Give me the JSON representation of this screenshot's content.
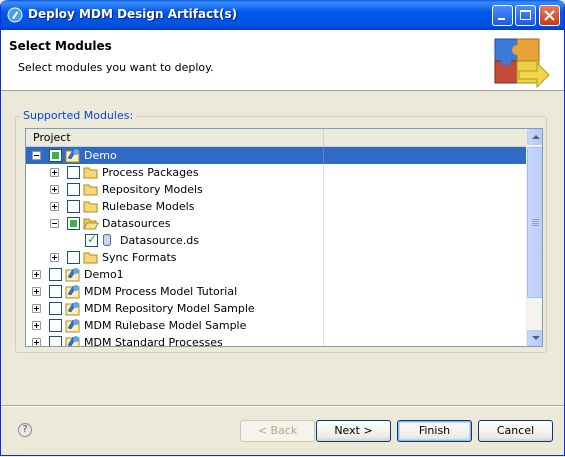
{
  "window": {
    "title": "Deploy MDM Design Artifact(s)"
  },
  "banner": {
    "title": "Select Modules",
    "message": "Select modules you want to deploy."
  },
  "group": {
    "label": "Supported Modules:"
  },
  "tree": {
    "column_header": "Project",
    "rows": [
      {
        "label": "Demo",
        "icon": "project-icon",
        "expander": "minus",
        "check": "partial",
        "selected": true
      },
      {
        "label": "Process Packages",
        "icon": "folder-icon",
        "expander": "plus",
        "check": "unchecked"
      },
      {
        "label": "Repository Models",
        "icon": "folder-icon",
        "expander": "plus",
        "check": "unchecked"
      },
      {
        "label": "Rulebase Models",
        "icon": "folder-icon",
        "expander": "plus",
        "check": "unchecked"
      },
      {
        "label": "Datasources",
        "icon": "folder-open-icon",
        "expander": "minus",
        "check": "partial"
      },
      {
        "label": "Datasource.ds",
        "icon": "datasource-file-icon",
        "expander": "none",
        "check": "checked"
      },
      {
        "label": "Sync Formats",
        "icon": "folder-icon",
        "expander": "plus",
        "check": "unchecked"
      },
      {
        "label": "Demo1",
        "icon": "project-icon",
        "expander": "plus",
        "check": "unchecked"
      },
      {
        "label": "MDM Process Model Tutorial",
        "icon": "project-icon",
        "expander": "plus",
        "check": "unchecked"
      },
      {
        "label": "MDM Repository Model Sample",
        "icon": "project-icon",
        "expander": "plus",
        "check": "unchecked"
      },
      {
        "label": "MDM Rulebase Model Sample",
        "icon": "project-icon",
        "expander": "plus",
        "check": "unchecked"
      },
      {
        "label": "MDM Standard Processes",
        "icon": "project-icon",
        "expander": "plus",
        "check": "unchecked"
      }
    ]
  },
  "buttons": {
    "back": "< Back",
    "next": "Next >",
    "finish": "Finish",
    "cancel": "Cancel",
    "help": "?"
  },
  "colors": {
    "selection": "#316ac5",
    "title_bar": "#0058ee",
    "group_label": "#0046d5"
  }
}
